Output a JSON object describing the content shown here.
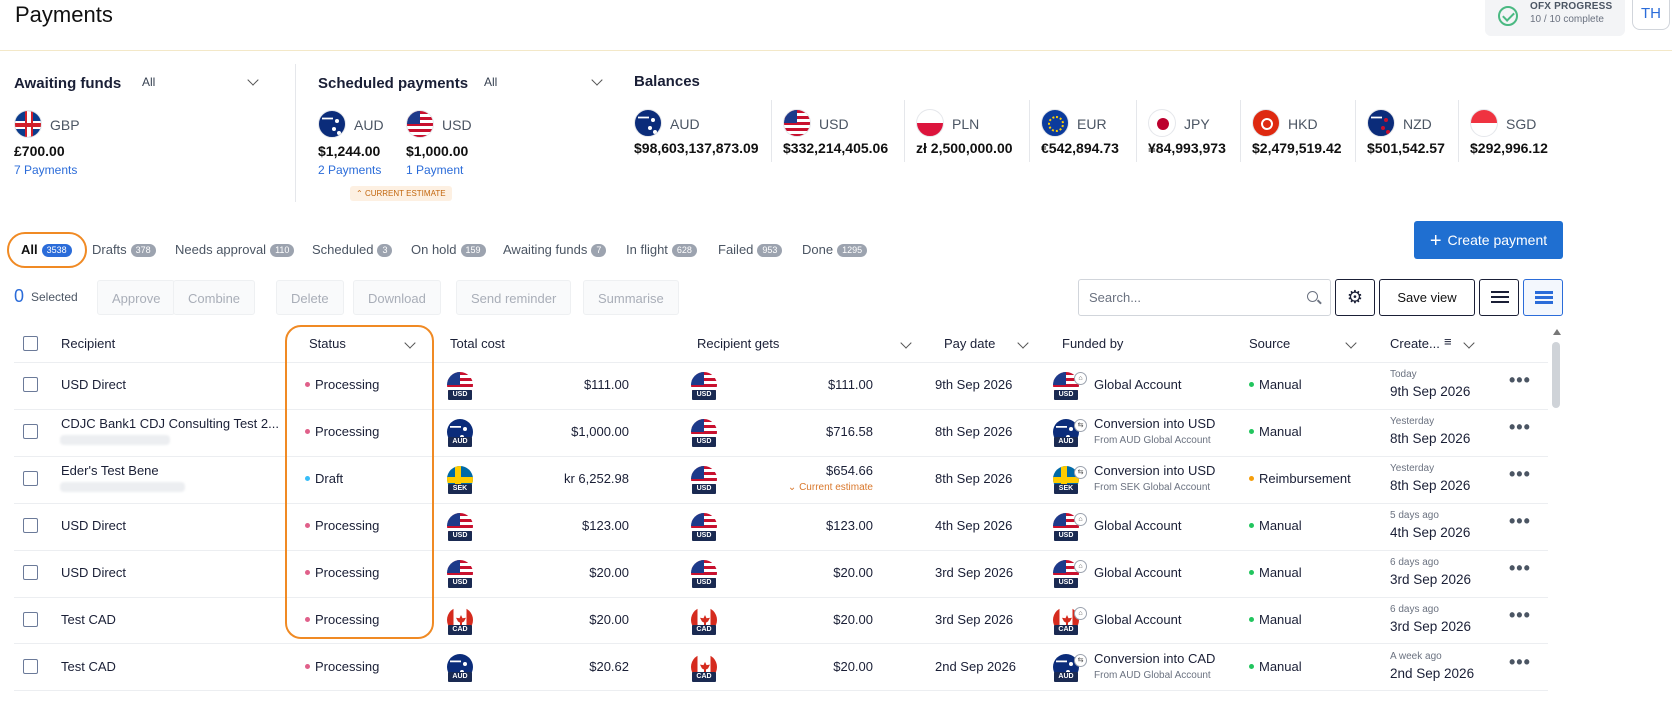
{
  "header": {
    "title": "Payments",
    "ofx_title": "OFX PROGRESS",
    "ofx_sub": "10 / 10 complete",
    "avatar": "TH"
  },
  "awaiting": {
    "title": "Awaiting funds",
    "filter": "All",
    "ccy": "GBP",
    "amount": "£700.00",
    "link": "7 Payments"
  },
  "scheduled": {
    "title": "Scheduled payments",
    "filter": "All",
    "items": [
      {
        "ccy": "AUD",
        "amount": "$1,244.00",
        "link": "2 Payments"
      },
      {
        "ccy": "USD",
        "amount": "$1,000.00",
        "link": "1 Payment"
      }
    ],
    "estimate": "CURRENT ESTIMATE"
  },
  "balances": {
    "title": "Balances",
    "items": [
      {
        "ccy": "AUD",
        "amount": "$98,603,137,873.09"
      },
      {
        "ccy": "USD",
        "amount": "$332,214,405.06"
      },
      {
        "ccy": "PLN",
        "amount": "zł 2,500,000.00"
      },
      {
        "ccy": "EUR",
        "amount": "€542,894.73"
      },
      {
        "ccy": "JPY",
        "amount": "¥84,993,973"
      },
      {
        "ccy": "HKD",
        "amount": "$2,479,519.42"
      },
      {
        "ccy": "NZD",
        "amount": "$501,542.57"
      },
      {
        "ccy": "SGD",
        "amount": "$292,996.12"
      }
    ]
  },
  "tabs": [
    {
      "label": "All",
      "count": "3538"
    },
    {
      "label": "Drafts",
      "count": "378"
    },
    {
      "label": "Needs approval",
      "count": "110"
    },
    {
      "label": "Scheduled",
      "count": "3"
    },
    {
      "label": "On hold",
      "count": "159"
    },
    {
      "label": "Awaiting funds",
      "count": "7"
    },
    {
      "label": "In flight",
      "count": "628"
    },
    {
      "label": "Failed",
      "count": "953"
    },
    {
      "label": "Done",
      "count": "1295"
    }
  ],
  "create_label": "Create payment",
  "toolbar": {
    "count": "0",
    "selected": "Selected",
    "actions": [
      "Approve",
      "Combine",
      "Delete",
      "Download",
      "Send reminder",
      "Summarise"
    ],
    "search_placeholder": "Search...",
    "save_view": "Save view"
  },
  "columns": {
    "recipient": "Recipient",
    "status": "Status",
    "total": "Total cost",
    "gets": "Recipient gets",
    "paydate": "Pay date",
    "funded": "Funded by",
    "source": "Source",
    "created": "Create..."
  },
  "rows": [
    {
      "recipient": "USD Direct",
      "status": "Processing",
      "total_ccy": "USD",
      "total": "$111.00",
      "gets_ccy": "USD",
      "gets": "$111.00",
      "gets_note": "",
      "paydate": "9th Sep 2026",
      "fund_ccy": "USD",
      "funded": "Global Account",
      "funded_sub": "",
      "source": "Manual",
      "created_rel": "Today",
      "created": "9th Sep 2026"
    },
    {
      "recipient": "CDJC Bank1 CDJ Consulting Test 2...",
      "status": "Processing",
      "total_ccy": "AUD",
      "total": "$1,000.00",
      "gets_ccy": "USD",
      "gets": "$716.58",
      "gets_note": "",
      "paydate": "8th Sep 2026",
      "fund_ccy": "AUD",
      "funded": "Conversion into USD",
      "funded_sub": "From AUD Global Account",
      "source": "Manual",
      "created_rel": "Yesterday",
      "created": "8th Sep 2026"
    },
    {
      "recipient": "Eder's Test Bene",
      "status": "Draft",
      "total_ccy": "SEK",
      "total": "kr 6,252.98",
      "gets_ccy": "USD",
      "gets": "$654.66",
      "gets_note": "Current estimate",
      "paydate": "8th Sep 2026",
      "fund_ccy": "SEK",
      "funded": "Conversion into USD",
      "funded_sub": "From SEK Global Account",
      "source": "Reimbursement",
      "created_rel": "Yesterday",
      "created": "8th Sep 2026"
    },
    {
      "recipient": "USD Direct",
      "status": "Processing",
      "total_ccy": "USD",
      "total": "$123.00",
      "gets_ccy": "USD",
      "gets": "$123.00",
      "gets_note": "",
      "paydate": "4th Sep 2026",
      "fund_ccy": "USD",
      "funded": "Global Account",
      "funded_sub": "",
      "source": "Manual",
      "created_rel": "5 days ago",
      "created": "4th Sep 2026"
    },
    {
      "recipient": "USD Direct",
      "status": "Processing",
      "total_ccy": "USD",
      "total": "$20.00",
      "gets_ccy": "USD",
      "gets": "$20.00",
      "gets_note": "",
      "paydate": "3rd Sep 2026",
      "fund_ccy": "USD",
      "funded": "Global Account",
      "funded_sub": "",
      "source": "Manual",
      "created_rel": "6 days ago",
      "created": "3rd Sep 2026"
    },
    {
      "recipient": "Test CAD",
      "status": "Processing",
      "total_ccy": "CAD",
      "total": "$20.00",
      "gets_ccy": "CAD",
      "gets": "$20.00",
      "gets_note": "",
      "paydate": "3rd Sep 2026",
      "fund_ccy": "CAD",
      "funded": "Global Account",
      "funded_sub": "",
      "source": "Manual",
      "created_rel": "6 days ago",
      "created": "3rd Sep 2026"
    },
    {
      "recipient": "Test CAD",
      "status": "Processing",
      "total_ccy": "AUD",
      "total": "$20.62",
      "gets_ccy": "CAD",
      "gets": "$20.00",
      "gets_note": "",
      "paydate": "2nd Sep 2026",
      "fund_ccy": "AUD",
      "funded": "Conversion into CAD",
      "funded_sub": "From AUD Global Account",
      "source": "Manual",
      "created_rel": "A week ago",
      "created": "2nd Sep 2026"
    }
  ],
  "colors": {
    "accent": "#2b6cd9",
    "processing": "#e0608a",
    "draft": "#38bdf8",
    "manual": "#22c55e",
    "reimbursement": "#f59e0b",
    "highlight": "#f08a24"
  }
}
